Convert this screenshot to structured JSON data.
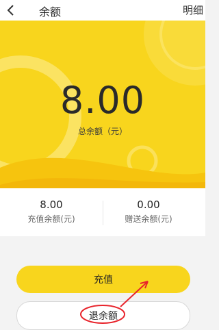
{
  "nav": {
    "title": "余额",
    "detail_link": "明细"
  },
  "hero": {
    "total_balance": "8.00",
    "total_balance_label": "总余额（元）"
  },
  "stats": {
    "recharge": {
      "value": "8.00",
      "label": "充值余额(元)"
    },
    "gift": {
      "value": "0.00",
      "label": "赠送余额(元)"
    }
  },
  "actions": {
    "recharge_label": "充值",
    "refund_label": "退余额"
  },
  "colors": {
    "brand_yellow": "#f8d51d",
    "annotation_red": "#e8232b"
  },
  "icons": {
    "back": "chevron-left-icon"
  }
}
